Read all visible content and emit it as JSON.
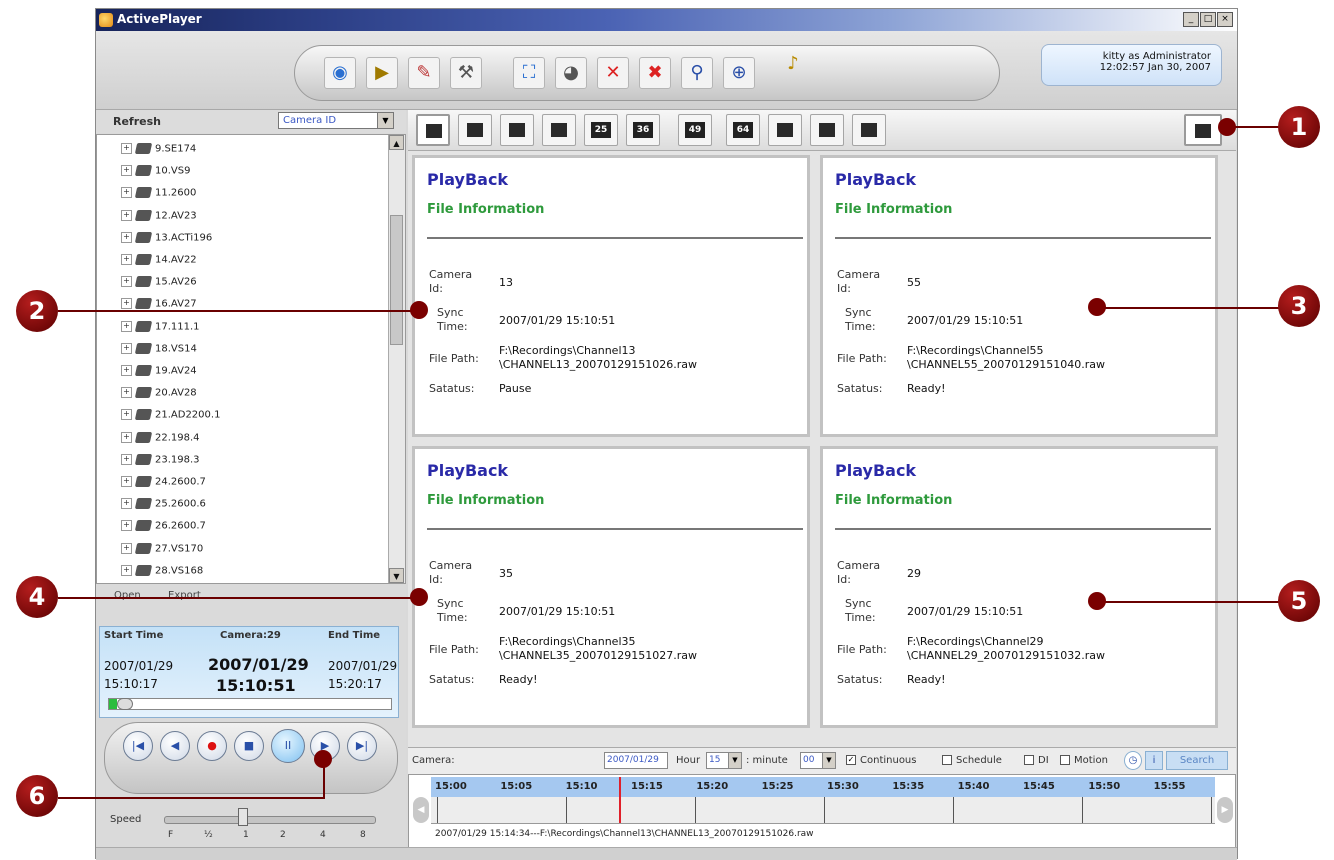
{
  "window": {
    "title": "ActivePlayer",
    "min": "_",
    "max": "□",
    "close": "×"
  },
  "toolbar": {
    "icons": [
      "eye-icon",
      "folder-icon",
      "map-icon",
      "tools-icon",
      "fullscreen-icon",
      "camera-icon",
      "disconnect-icon",
      "disconnect-all-icon",
      "search-icon",
      "zoom-icon",
      "audio-icon"
    ]
  },
  "user": {
    "line1": "kitty as Administrator",
    "line2": "12:02:57 Jan 30, 2007"
  },
  "left": {
    "refresh": "Refresh",
    "select_value": "Camera ID",
    "cameras": [
      "9.SE174",
      "10.VS9",
      "11.2600",
      "12.AV23",
      "13.ACTi196",
      "14.AV22",
      "15.AV26",
      "16.AV27",
      "17.111.1",
      "18.VS14",
      "19.AV24",
      "20.AV28",
      "21.AD2200.1",
      "22.198.4",
      "23.198.3",
      "24.2600.7",
      "25.2600.6",
      "26.2600.7",
      "27.VS170",
      "28.VS168"
    ],
    "open": "Open",
    "export": "Export"
  },
  "timepanel": {
    "start_label": "Start Time",
    "camera_label": "Camera:29",
    "end_label": "End Time",
    "start_date": "2007/01/29",
    "start_time": "15:10:17",
    "cur_date": "2007/01/29",
    "cur_time": "15:10:51",
    "end_date": "2007/01/29",
    "end_time": "15:20:17",
    "progress": 0.03
  },
  "playback_buttons": [
    "|◀",
    "◀",
    "●",
    "■",
    "II",
    "▶",
    "▶|"
  ],
  "speed": {
    "label": "Speed",
    "ticks": [
      "F",
      "½",
      "1",
      "2",
      "4",
      "8"
    ]
  },
  "layouts": [
    "1",
    "4",
    "9",
    "13",
    "25",
    "36",
    "49",
    "64",
    "8a",
    "8b",
    "8c"
  ],
  "layout_labels": {
    "25": "25",
    "36": "36",
    "49": "49",
    "64": "64"
  },
  "panes": [
    {
      "title": "PlayBack",
      "sub": "File Information",
      "camera_key": "Camera Id:",
      "camera": "13",
      "sync_key": "Sync Time:",
      "sync": "2007/01/29 15:10:51",
      "path_key": "File Path:",
      "path1": "F:\\Recordings\\Channel13",
      "path2": "\\CHANNEL13_20070129151026.raw",
      "status_key": "Satatus:",
      "status": "Pause"
    },
    {
      "title": "PlayBack",
      "sub": "File Information",
      "camera_key": "Camera Id:",
      "camera": "55",
      "sync_key": "Sync Time:",
      "sync": "2007/01/29 15:10:51",
      "path_key": "File Path:",
      "path1": "F:\\Recordings\\Channel55",
      "path2": "\\CHANNEL55_20070129151040.raw",
      "status_key": "Satatus:",
      "status": "Ready!"
    },
    {
      "title": "PlayBack",
      "sub": "File Information",
      "camera_key": "Camera Id:",
      "camera": "35",
      "sync_key": "Sync Time:",
      "sync": "2007/01/29 15:10:51",
      "path_key": "File Path:",
      "path1": "F:\\Recordings\\Channel35",
      "path2": "\\CHANNEL35_20070129151027.raw",
      "status_key": "Satatus:",
      "status": "Ready!"
    },
    {
      "title": "PlayBack",
      "sub": "File Information",
      "camera_key": "Camera Id:",
      "camera": "29",
      "sync_key": "Sync Time:",
      "sync": "2007/01/29 15:10:51",
      "path_key": "File Path:",
      "path1": "F:\\Recordings\\Channel29",
      "path2": "\\CHANNEL29_20070129151032.raw",
      "status_key": "Satatus:",
      "status": "Ready!"
    }
  ],
  "search": {
    "camera": "Camera:",
    "date": "2007/01/29",
    "hour_label": "Hour",
    "hour": "15",
    "minute_label": ": minute",
    "minute": "00",
    "continuous": "Continuous",
    "schedule": "Schedule",
    "di": "DI",
    "motion": "Motion",
    "button": "Search"
  },
  "timeline": {
    "labels": [
      "15:00",
      "15:05",
      "15:10",
      "15:15",
      "15:20",
      "15:25",
      "15:30",
      "15:35",
      "15:40",
      "15:45",
      "15:50",
      "15:55"
    ],
    "info": "2007/01/29 15:14:34---F:\\Recordings\\Channel13\\CHANNEL13_20070129151026.raw"
  },
  "callouts": [
    "1",
    "2",
    "3",
    "4",
    "5",
    "6"
  ],
  "colors": {
    "playback_title": "#2a2aa8",
    "file_info": "#2e9a3c",
    "callout": "#7a0000"
  }
}
